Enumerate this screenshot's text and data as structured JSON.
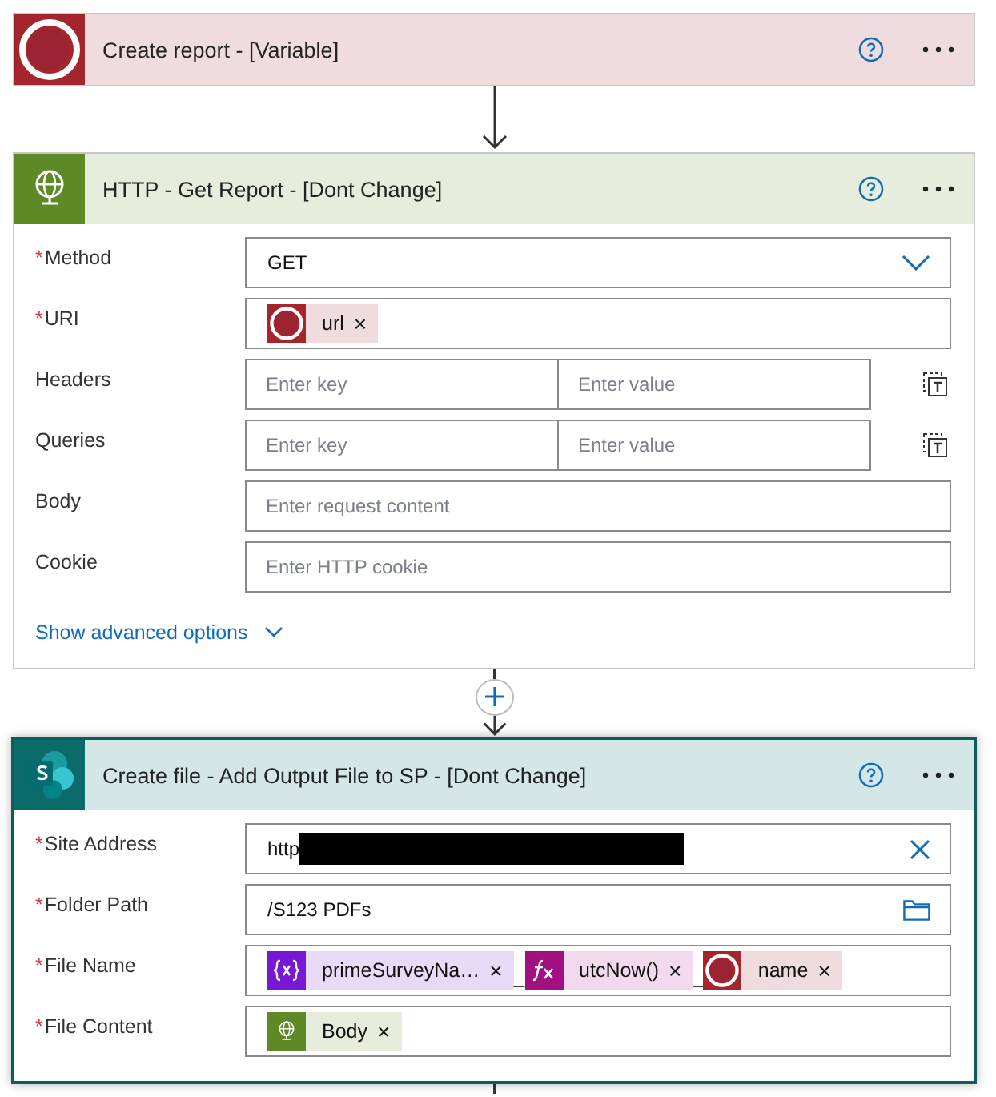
{
  "cards": [
    {
      "title": "Create report - [Variable]",
      "kind": "survey",
      "selected": false
    },
    {
      "title": "HTTP - Get Report - [Dont Change]",
      "kind": "http",
      "selected": false,
      "fields": [
        {
          "kind": "dropdown",
          "label": "Method",
          "required_mark": "*",
          "value": "GET"
        },
        {
          "kind": "tokens",
          "label": "URI",
          "required_mark": "*",
          "items": [
            {
              "kind": "survey",
              "label": "url",
              "remove": "×"
            }
          ]
        },
        {
          "kind": "keyvalue",
          "label": "Headers",
          "key_placeholder": "Enter key",
          "value_placeholder": "Enter value"
        },
        {
          "kind": "keyvalue",
          "label": "Queries",
          "key_placeholder": "Enter key",
          "value_placeholder": "Enter value"
        },
        {
          "kind": "text",
          "label": "Body",
          "placeholder": "Enter request content"
        },
        {
          "kind": "text",
          "label": "Cookie",
          "placeholder": "Enter HTTP cookie"
        }
      ],
      "link": "Show advanced options"
    },
    {
      "title": "Create file - Add Output File to SP - [Dont Change]",
      "kind": "sharepoint",
      "selected": true,
      "fields": [
        {
          "kind": "site",
          "label": "Site Address",
          "required_mark": "*",
          "value": "http"
        },
        {
          "kind": "folder",
          "label": "Folder Path",
          "required_mark": "*",
          "value": "/S123 PDFs"
        },
        {
          "kind": "tokens",
          "label": "File Name",
          "required_mark": "*",
          "items": [
            {
              "kind": "variable",
              "label": "primeSurveyNa…",
              "remove": "×"
            },
            {
              "kind": "text",
              "text": "_"
            },
            {
              "kind": "expression",
              "label": "utcNow()",
              "remove": "×"
            },
            {
              "kind": "text",
              "text": "_"
            },
            {
              "kind": "survey",
              "label": "name",
              "remove": "×"
            }
          ]
        },
        {
          "kind": "tokens",
          "label": "File Content",
          "required_mark": "*",
          "items": [
            {
              "kind": "http",
              "label": "Body",
              "remove": "×"
            }
          ]
        }
      ]
    }
  ]
}
